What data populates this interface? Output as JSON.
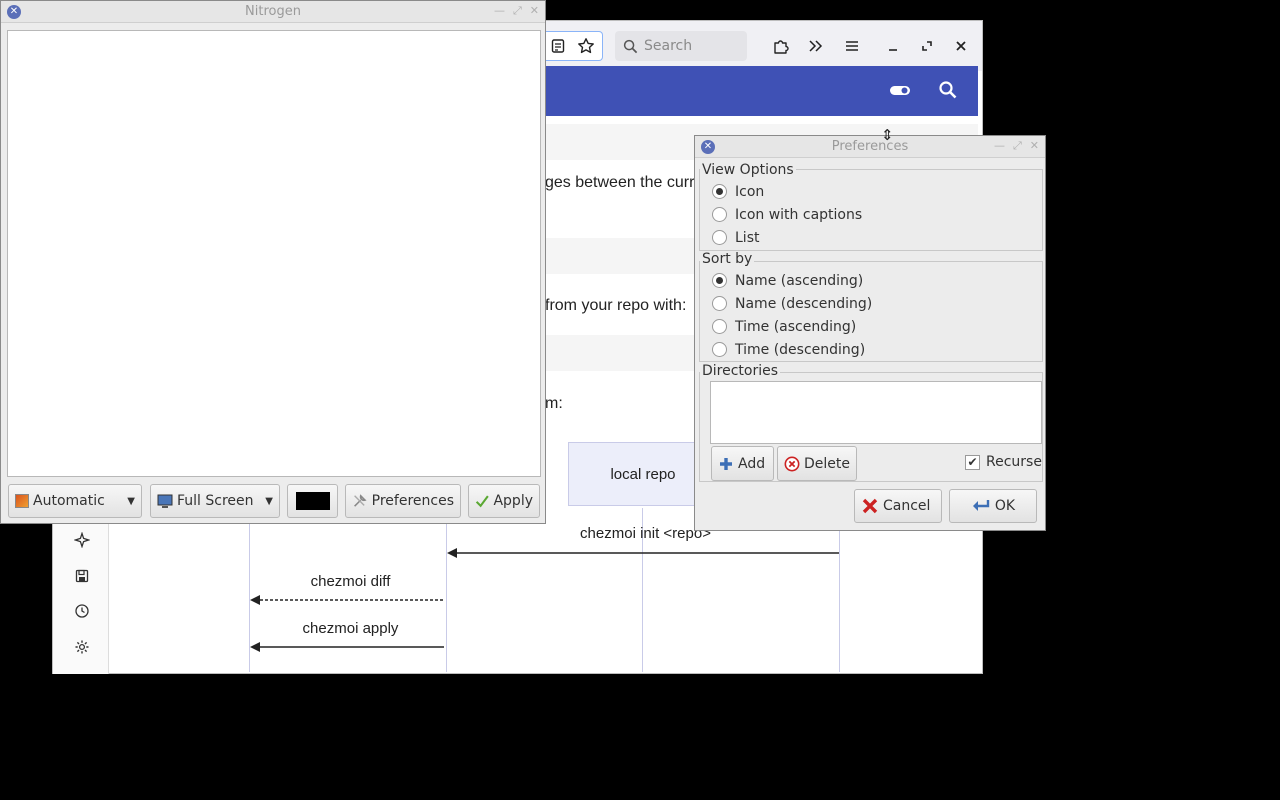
{
  "nitrogen": {
    "title": "Nitrogen",
    "mode_select": "Automatic",
    "size_select": "Full Screen",
    "bg_color": "#000000",
    "preferences_button": "Preferences",
    "apply_button": "Apply"
  },
  "browser": {
    "search_placeholder": "Search",
    "header_color": "#3f51b5",
    "text_line_1": "ges between the curr",
    "text_line_2": "from your repo with:",
    "text_line_3": "m:",
    "diagram": {
      "participant": "local repo",
      "message_1": "chezmoi init <repo>",
      "message_2": "chezmoi diff",
      "message_3": "chezmoi apply"
    }
  },
  "preferences": {
    "title": "Preferences",
    "view_options": {
      "title": "View Options",
      "options": [
        "Icon",
        "Icon with captions",
        "List"
      ],
      "selected": "Icon"
    },
    "sort_by": {
      "title": "Sort by",
      "options": [
        "Name (ascending)",
        "Name (descending)",
        "Time (ascending)",
        "Time (descending)"
      ],
      "selected": "Name (ascending)"
    },
    "directories": {
      "title": "Directories",
      "add_button": "Add",
      "delete_button": "Delete",
      "recurse_label": "Recurse",
      "recurse_checked": true
    },
    "cancel_button": "Cancel",
    "ok_button": "OK"
  }
}
